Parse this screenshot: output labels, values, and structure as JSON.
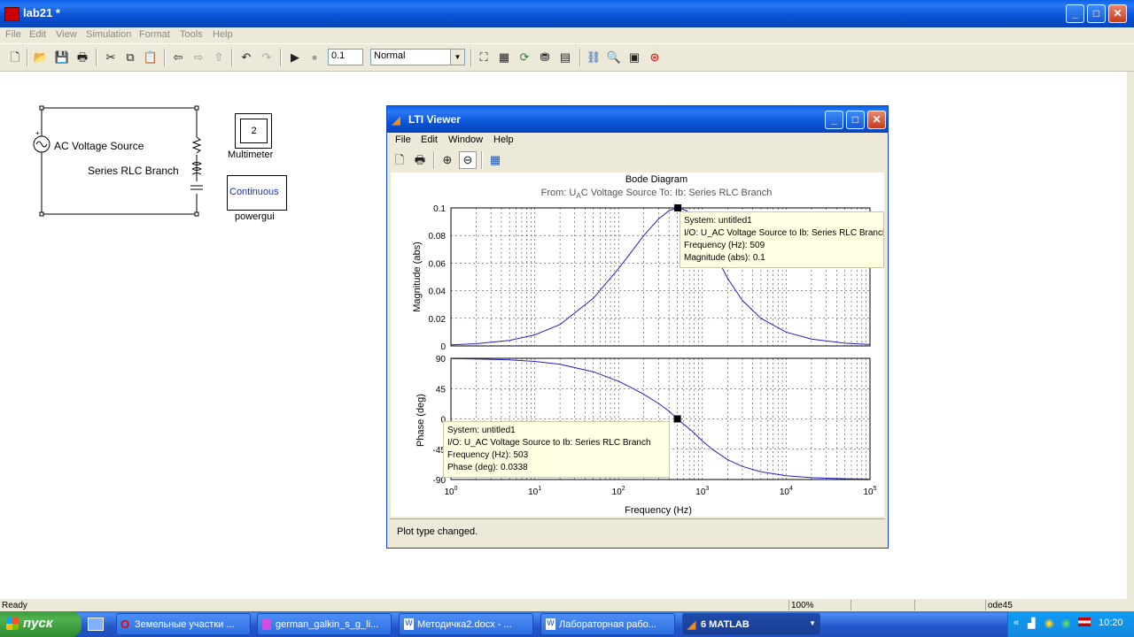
{
  "window": {
    "title": "lab21 *"
  },
  "menu": [
    "File",
    "Edit",
    "View",
    "Simulation",
    "Format",
    "Tools",
    "Help"
  ],
  "toolbar": {
    "stop_time": "0.1",
    "sim_mode": "Normal"
  },
  "model": {
    "ac_source_label": "AC Voltage Source",
    "rlc_label": "Series RLC Branch",
    "multimeter_value": "2",
    "multimeter_label": "Multimeter",
    "powergui_text": "Continuous",
    "powergui_label": "powergui"
  },
  "lti": {
    "title": "LTI Viewer",
    "menu": [
      "File",
      "Edit",
      "Window",
      "Help"
    ],
    "plot_title": "Bode Diagram",
    "io_from": "From: U",
    "io_sub": "A",
    "io_rest": "C Voltage Source  To: Ib: Series RLC Branch",
    "mag_ylabel": "Magnitude (abs)",
    "phase_ylabel": "Phase (deg)",
    "xlabel": "Frequency  (Hz)",
    "status": "Plot type changed.",
    "tip_mag": {
      "line1": "System: untitled1",
      "line2": "I/O: U_AC Voltage Source to Ib: Series RLC Branch",
      "line3": "Frequency (Hz): 509",
      "line4": "Magnitude (abs): 0.1"
    },
    "tip_phase": {
      "line1": "System: untitled1",
      "line2": "I/O: U_AC Voltage Source to Ib: Series RLC Branch",
      "line3": "Frequency (Hz): 503",
      "line4": "Phase (deg): 0.0338"
    }
  },
  "chart_data": [
    {
      "type": "line",
      "title": "Bode Diagram",
      "ylabel": "Magnitude (abs)",
      "xlabel": "Frequency  (Hz)",
      "x_scale": "log",
      "xlim": [
        1,
        100000
      ],
      "ylim": [
        0,
        0.1
      ],
      "yticks": [
        "0",
        "0.02",
        "0.04",
        "0.06",
        "0.08",
        "0.1"
      ],
      "grid": true,
      "series": [
        {
          "x": [
            1,
            2,
            5,
            10,
            20,
            50,
            100,
            150,
            200,
            300,
            400,
            509,
            650,
            800,
            1000,
            1300,
            2000,
            3000,
            5000,
            10000,
            20000,
            50000,
            100000
          ],
          "y": [
            0.0008,
            0.0016,
            0.004,
            0.008,
            0.0155,
            0.0345,
            0.056,
            0.07,
            0.08,
            0.092,
            0.098,
            0.1,
            0.098,
            0.093,
            0.084,
            0.071,
            0.049,
            0.033,
            0.02,
            0.01,
            0.005,
            0.002,
            0.001
          ]
        }
      ]
    },
    {
      "type": "line",
      "ylabel": "Phase (deg)",
      "xlabel": "Frequency  (Hz)",
      "x_scale": "log",
      "xlim": [
        1,
        100000
      ],
      "ylim": [
        -90,
        90
      ],
      "yticks": [
        "90",
        "45",
        "0",
        "-45",
        "-90"
      ],
      "xticks": [
        "10",
        "10",
        "10",
        "10",
        "10",
        "10"
      ],
      "xtick_exponents": [
        "0",
        "1",
        "2",
        "3",
        "4",
        "5"
      ],
      "grid": true,
      "series": [
        {
          "x": [
            1,
            2,
            5,
            10,
            20,
            50,
            100,
            150,
            200,
            300,
            400,
            503,
            650,
            800,
            1000,
            1300,
            2000,
            3000,
            5000,
            10000,
            20000,
            50000,
            100000
          ],
          "y": [
            89.5,
            89.1,
            87.7,
            85.4,
            81.1,
            70,
            56,
            45,
            36.5,
            23,
            11.6,
            0.0338,
            -11.5,
            -21,
            -32.7,
            -44.7,
            -60.6,
            -70.6,
            -78.4,
            -84.3,
            -87.2,
            -88.8,
            -89.4
          ]
        }
      ]
    }
  ],
  "statusbar": {
    "left": "Ready",
    "zoom": "100%",
    "solver": "ode45"
  },
  "taskbar": {
    "start": "пуск",
    "items": [
      "Земельные участки ...",
      "german_galkin_s_g_li...",
      "Методичка2.docx - ...",
      "Лабораторная рабо...",
      "6 MATLAB"
    ],
    "clock": "10:20"
  }
}
